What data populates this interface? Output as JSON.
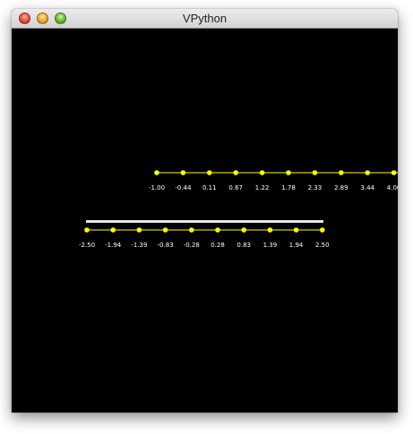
{
  "window": {
    "title": "VPython"
  },
  "scene": {
    "background_color": "#000000",
    "axis_color": "#ffff00",
    "bar_color": "#e8e8e8",
    "label_color": "#ffffff",
    "axes": [
      {
        "name": "upper-axis",
        "labels": [
          "-1.00",
          "-0.44",
          "0.11",
          "0.67",
          "1.22",
          "1.78",
          "2.33",
          "2.89",
          "3.44",
          "4.00"
        ]
      },
      {
        "name": "lower-axis",
        "labels": [
          "-2.50",
          "-1.94",
          "-1.39",
          "-0.83",
          "-0.28",
          "0.28",
          "0.83",
          "1.39",
          "1.94",
          "2.50"
        ]
      }
    ]
  }
}
